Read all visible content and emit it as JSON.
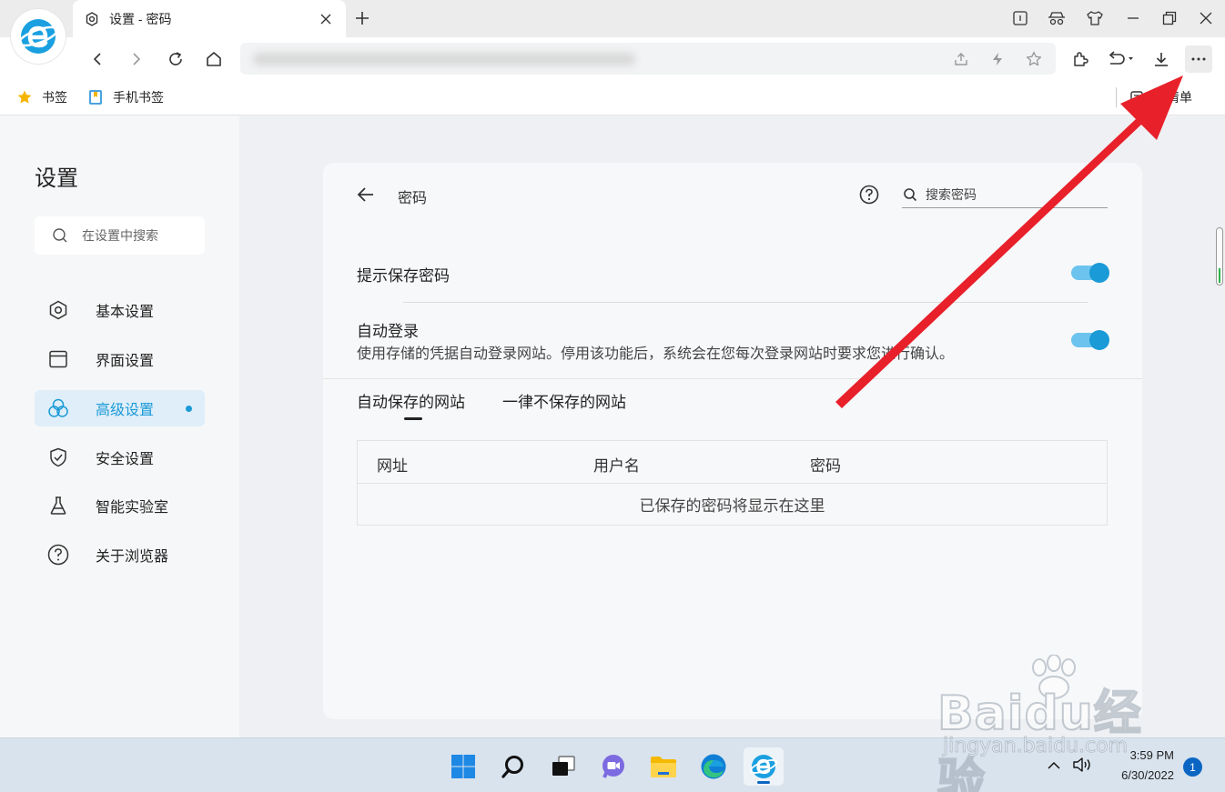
{
  "tab": {
    "title": "设置 - 密码"
  },
  "bookmarks": [
    {
      "label": "书签",
      "icon": "star-icon"
    },
    {
      "label": "手机书签",
      "icon": "phone-bookmark-icon"
    }
  ],
  "reading_list_label": "读清单",
  "sidebar": {
    "title": "设置",
    "search_placeholder": "在设置中搜索",
    "items": [
      {
        "label": "基本设置",
        "icon": "hexagon-gear-icon"
      },
      {
        "label": "界面设置",
        "icon": "window-icon"
      },
      {
        "label": "高级设置",
        "icon": "circles-icon",
        "active": true
      },
      {
        "label": "安全设置",
        "icon": "shield-check-icon"
      },
      {
        "label": "智能实验室",
        "icon": "flask-icon"
      },
      {
        "label": "关于浏览器",
        "icon": "question-circle-icon"
      }
    ]
  },
  "passwords": {
    "page_title": "密码",
    "search_placeholder": "搜索密码",
    "settings": {
      "offer_to_save": {
        "label": "提示保存密码",
        "enabled": true
      },
      "auto_signin": {
        "label": "自动登录",
        "description": "使用存储的凭据自动登录网站。停用该功能后，系统会在您每次登录网站时要求您进行确认。",
        "enabled": true
      }
    },
    "tabs": [
      {
        "label": "自动保存的网站",
        "active": true
      },
      {
        "label": "一律不保存的网站",
        "active": false
      }
    ],
    "table": {
      "columns": [
        "网址",
        "用户名",
        "密码"
      ],
      "empty_message": "已保存的密码将显示在这里"
    }
  },
  "taskbar": {
    "time": "3:59 PM",
    "date": "6/30/2022",
    "notification_count": "1"
  },
  "watermark": {
    "logo": "Baidu经验",
    "url": "jingyan.baidu.com"
  },
  "colors": {
    "accent": "#1a9ad6",
    "toggle_track": "#6cc4ee",
    "annotation_arrow": "#e8202a"
  }
}
